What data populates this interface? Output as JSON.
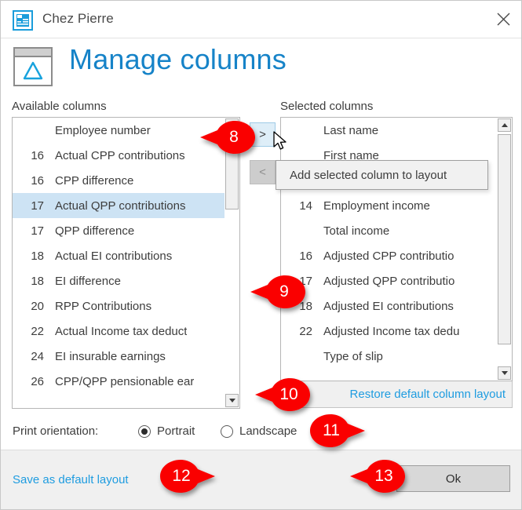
{
  "window": {
    "title": "Chez Pierre",
    "app_icon": "document-report-icon",
    "close_icon": "close-icon"
  },
  "header": {
    "title": "Manage columns",
    "icon": "window-triangle-icon",
    "accent_color": "#1683c8"
  },
  "available": {
    "label": "Available columns",
    "rows": [
      {
        "num": "",
        "text": "Employee number",
        "selected": false
      },
      {
        "num": "16",
        "text": "Actual CPP contributions",
        "selected": false
      },
      {
        "num": "16",
        "text": "CPP difference",
        "selected": false
      },
      {
        "num": "17",
        "text": "Actual QPP contributions",
        "selected": true
      },
      {
        "num": "17",
        "text": "QPP difference",
        "selected": false
      },
      {
        "num": "18",
        "text": "Actual EI contributions",
        "selected": false
      },
      {
        "num": "18",
        "text": "EI difference",
        "selected": false
      },
      {
        "num": "20",
        "text": "RPP Contributions",
        "selected": false
      },
      {
        "num": "22",
        "text": "Actual Income tax deduct",
        "selected": false
      },
      {
        "num": "24",
        "text": "EI insurable earnings",
        "selected": false
      },
      {
        "num": "26",
        "text": "CPP/QPP pensionable ear",
        "selected": false
      }
    ],
    "scrollbar": {
      "down_arrow_icon": "chevron-down-icon"
    }
  },
  "selected": {
    "label": "Selected columns",
    "rows": [
      {
        "num": "",
        "text": "Last name",
        "selected": false
      },
      {
        "num": "",
        "text": "First name",
        "selected": false
      },
      {
        "num": "",
        "text": "",
        "selected": false
      },
      {
        "num": "14",
        "text": "Employment income",
        "selected": false
      },
      {
        "num": "",
        "text": "Total income",
        "selected": false
      },
      {
        "num": "16",
        "text": "Adjusted CPP contributio",
        "selected": false
      },
      {
        "num": "17",
        "text": "Adjusted QPP contributio",
        "selected": false
      },
      {
        "num": "18",
        "text": "Adjusted EI contributions",
        "selected": false
      },
      {
        "num": "22",
        "text": "Adjusted Income tax dedu",
        "selected": false
      },
      {
        "num": "",
        "text": "Type of slip",
        "selected": false
      }
    ],
    "scrollbar": {
      "up_arrow_icon": "chevron-up-icon",
      "down_arrow_icon": "chevron-down-icon"
    }
  },
  "transfer": {
    "add_label": ">",
    "remove_label": "<",
    "tooltip": "Add selected column to layout"
  },
  "links": {
    "restore_default": "Restore default column layout",
    "save_default": "Save as default layout",
    "link_color": "#1e9ce0"
  },
  "orientation": {
    "label": "Print orientation:",
    "options": [
      {
        "label": "Portrait",
        "checked": true
      },
      {
        "label": "Landscape",
        "checked": false
      }
    ]
  },
  "footer": {
    "ok_label": "Ok"
  },
  "callouts": {
    "badge_color": "#fa0000",
    "items": [
      {
        "num": "8",
        "dir": "right"
      },
      {
        "num": "9",
        "dir": "right"
      },
      {
        "num": "10",
        "dir": "right"
      },
      {
        "num": "11",
        "dir": "left"
      },
      {
        "num": "12",
        "dir": "left"
      },
      {
        "num": "13",
        "dir": "right"
      }
    ]
  }
}
